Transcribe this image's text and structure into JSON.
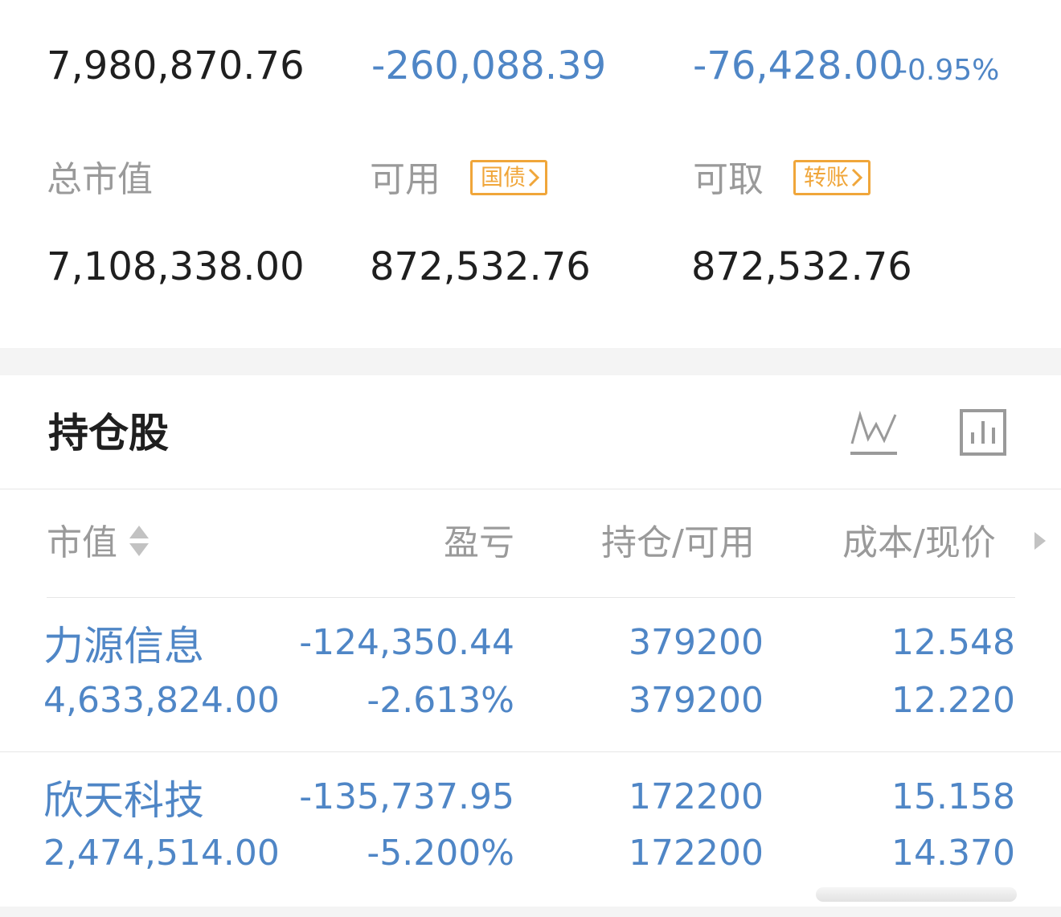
{
  "summary": {
    "total_assets": "7,980,870.76",
    "total_pnl": "-260,088.39",
    "today_pnl": "-76,428.00",
    "today_pnl_pct": "-0.95%",
    "market_value_label": "总市值",
    "market_value": "7,108,338.00",
    "available_label": "可用",
    "available_tag": "国债",
    "available": "872,532.76",
    "withdrawable_label": "可取",
    "withdrawable_tag": "转账",
    "withdrawable": "872,532.76"
  },
  "holdings": {
    "title": "持仓股",
    "icons": [
      "line-chart-icon",
      "bar-chart-icon"
    ],
    "columns": {
      "market_value": "市值",
      "pnl": "盈亏",
      "position": "持仓/可用",
      "cost_price": "成本/现价"
    },
    "rows": [
      {
        "name": "力源信息",
        "market_value": "4,633,824.00",
        "pnl": "-124,350.44",
        "pnl_pct": "-2.613%",
        "position": "379200",
        "available": "379200",
        "cost": "12.548",
        "price": "12.220"
      },
      {
        "name": "欣天科技",
        "market_value": "2,474,514.00",
        "pnl": "-135,737.95",
        "pnl_pct": "-5.200%",
        "position": "172200",
        "available": "172200",
        "cost": "15.158",
        "price": "14.370"
      }
    ]
  },
  "colors": {
    "accent_blue": "#4f86c6",
    "tag_orange": "#f0a63a",
    "text_dark": "#1f1f1f",
    "text_gray": "#9a9a9a"
  }
}
